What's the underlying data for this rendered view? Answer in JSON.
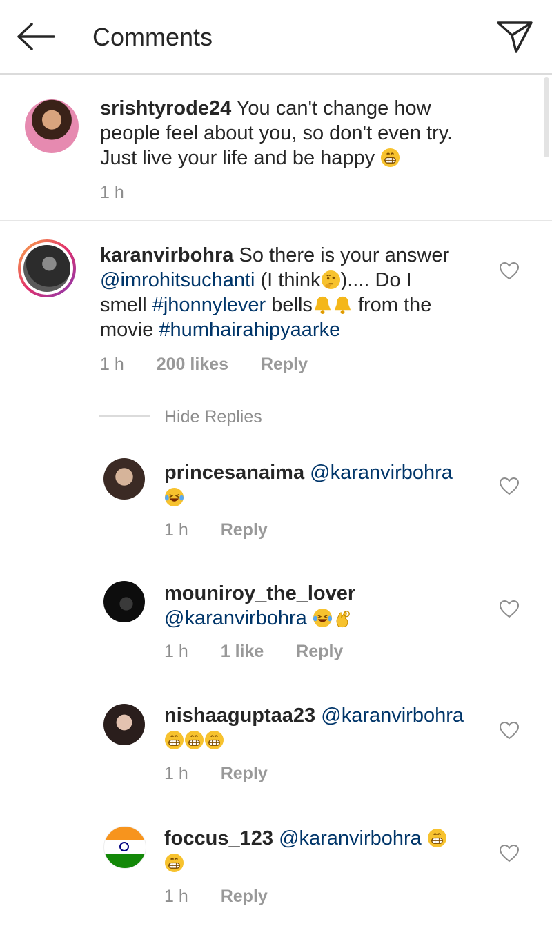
{
  "header": {
    "title": "Comments",
    "back_icon": "back-arrow-icon",
    "share_icon": "send-paper-plane-icon"
  },
  "caption": {
    "username": "srishtyrode24",
    "lines": [
      "You can't change how",
      "people feel about you, so don't even try.",
      "Just live your life and be happy"
    ],
    "emoji": "grinning-face",
    "time": "1 h"
  },
  "comment": {
    "username": "karanvirbohra",
    "line1": "So there is your answer",
    "line2_mention": "@imrohitsuchanti",
    "line2_text_a": " (I think",
    "line2_text_b": ").... Do I",
    "line3_a": "smell ",
    "line3_tag": "#jhonnylever",
    "line3_b": " bells",
    "line3_c": " from the",
    "line4_a": "movie ",
    "line4_tag": "#humhairahipyaarke",
    "time": "1 h",
    "likes": "200 likes",
    "reply": "Reply",
    "hide_replies": "Hide Replies"
  },
  "replies": [
    {
      "username": "princesanaima",
      "mention": "@karanvirbohra",
      "time": "1 h",
      "likes": "",
      "reply": "Reply"
    },
    {
      "username": "mouniroy_the_lover",
      "mention": "@karanvirbohra",
      "time": "1 h",
      "likes": "1 like",
      "reply": "Reply"
    },
    {
      "username": "nishaaguptaa23",
      "mention": "@karanvirbohra",
      "time": "1 h",
      "likes": "",
      "reply": "Reply"
    },
    {
      "username": "foccus_123",
      "mention": "@karanvirbohra",
      "time": "1 h",
      "likes": "",
      "reply": "Reply"
    }
  ],
  "colors": {
    "mention": "#003569",
    "meta": "#8e8e8e",
    "divider": "#dbdbdb",
    "story_ring": "#e1306c"
  }
}
